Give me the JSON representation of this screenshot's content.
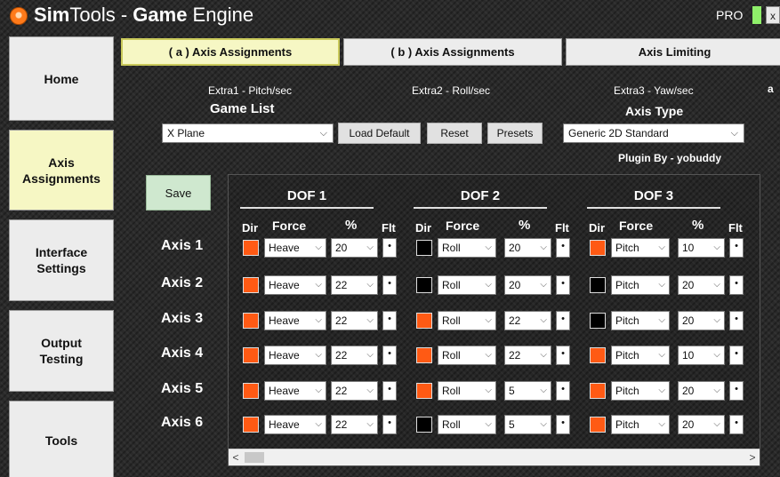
{
  "window": {
    "title_brand_bold": "Sim",
    "title_brand_rest": "Tools - ",
    "title_bold2": "Game",
    "title_rest2": " Engine",
    "pro_label": "PRO",
    "close_glyph": "x"
  },
  "sidebar": {
    "items": [
      {
        "label": "Home",
        "active": false
      },
      {
        "label": "Axis\nAssignments",
        "active": true
      },
      {
        "label": "Interface\nSettings",
        "active": false
      },
      {
        "label": "Output\nTesting",
        "active": false
      },
      {
        "label": "Tools",
        "active": false
      }
    ]
  },
  "tabs": [
    {
      "label": "( a ) Axis Assignments",
      "active": true
    },
    {
      "label": "( b ) Axis Assignments",
      "active": false
    },
    {
      "label": "Axis Limiting",
      "active": false
    }
  ],
  "extras": {
    "extra1": "Extra1 - Pitch/sec",
    "extra2": "Extra2 - Roll/sec",
    "extra3": "Extra3 - Yaw/sec",
    "extra_a": "a"
  },
  "game_list": {
    "label": "Game List",
    "selected": "X Plane",
    "load_default": "Load Default",
    "reset": "Reset",
    "presets": "Presets"
  },
  "axis_type": {
    "label": "Axis Type",
    "selected": "Generic 2D Standard",
    "plugin_by": "Plugin By - yobuddy"
  },
  "save_label": "Save",
  "dof_titles": [
    "DOF 1",
    "DOF 2",
    "DOF 3"
  ],
  "columns": {
    "dir": "Dir",
    "force": "Force",
    "percent": "%",
    "flt": "Flt"
  },
  "flt_glyph": "•",
  "dropdown_arrow": "⌵",
  "scroll": {
    "left": "<",
    "right": ">"
  },
  "colors": {
    "dir_on": "#ff5a14",
    "dir_off": "#000000",
    "save_bg": "#cfe8cf",
    "active_tab": "#f6f7c4"
  },
  "axes": [
    {
      "label": "Axis 1",
      "dofs": [
        {
          "dir": "on",
          "force": "Heave",
          "percent": "20"
        },
        {
          "dir": "off",
          "force": "Roll",
          "percent": "20"
        },
        {
          "dir": "on",
          "force": "Pitch",
          "percent": "10"
        }
      ]
    },
    {
      "label": "Axis 2",
      "dofs": [
        {
          "dir": "on",
          "force": "Heave",
          "percent": "22"
        },
        {
          "dir": "off",
          "force": "Roll",
          "percent": "20"
        },
        {
          "dir": "off",
          "force": "Pitch",
          "percent": "20"
        }
      ]
    },
    {
      "label": "Axis 3",
      "dofs": [
        {
          "dir": "on",
          "force": "Heave",
          "percent": "22"
        },
        {
          "dir": "on",
          "force": "Roll",
          "percent": "22"
        },
        {
          "dir": "off",
          "force": "Pitch",
          "percent": "20"
        }
      ]
    },
    {
      "label": "Axis 4",
      "dofs": [
        {
          "dir": "on",
          "force": "Heave",
          "percent": "22"
        },
        {
          "dir": "on",
          "force": "Roll",
          "percent": "22"
        },
        {
          "dir": "on",
          "force": "Pitch",
          "percent": "10"
        }
      ]
    },
    {
      "label": "Axis 5",
      "dofs": [
        {
          "dir": "on",
          "force": "Heave",
          "percent": "22"
        },
        {
          "dir": "on",
          "force": "Roll",
          "percent": "5"
        },
        {
          "dir": "on",
          "force": "Pitch",
          "percent": "20"
        }
      ]
    },
    {
      "label": "Axis 6",
      "dofs": [
        {
          "dir": "on",
          "force": "Heave",
          "percent": "22"
        },
        {
          "dir": "off",
          "force": "Roll",
          "percent": "5"
        },
        {
          "dir": "on",
          "force": "Pitch",
          "percent": "20"
        }
      ]
    }
  ]
}
